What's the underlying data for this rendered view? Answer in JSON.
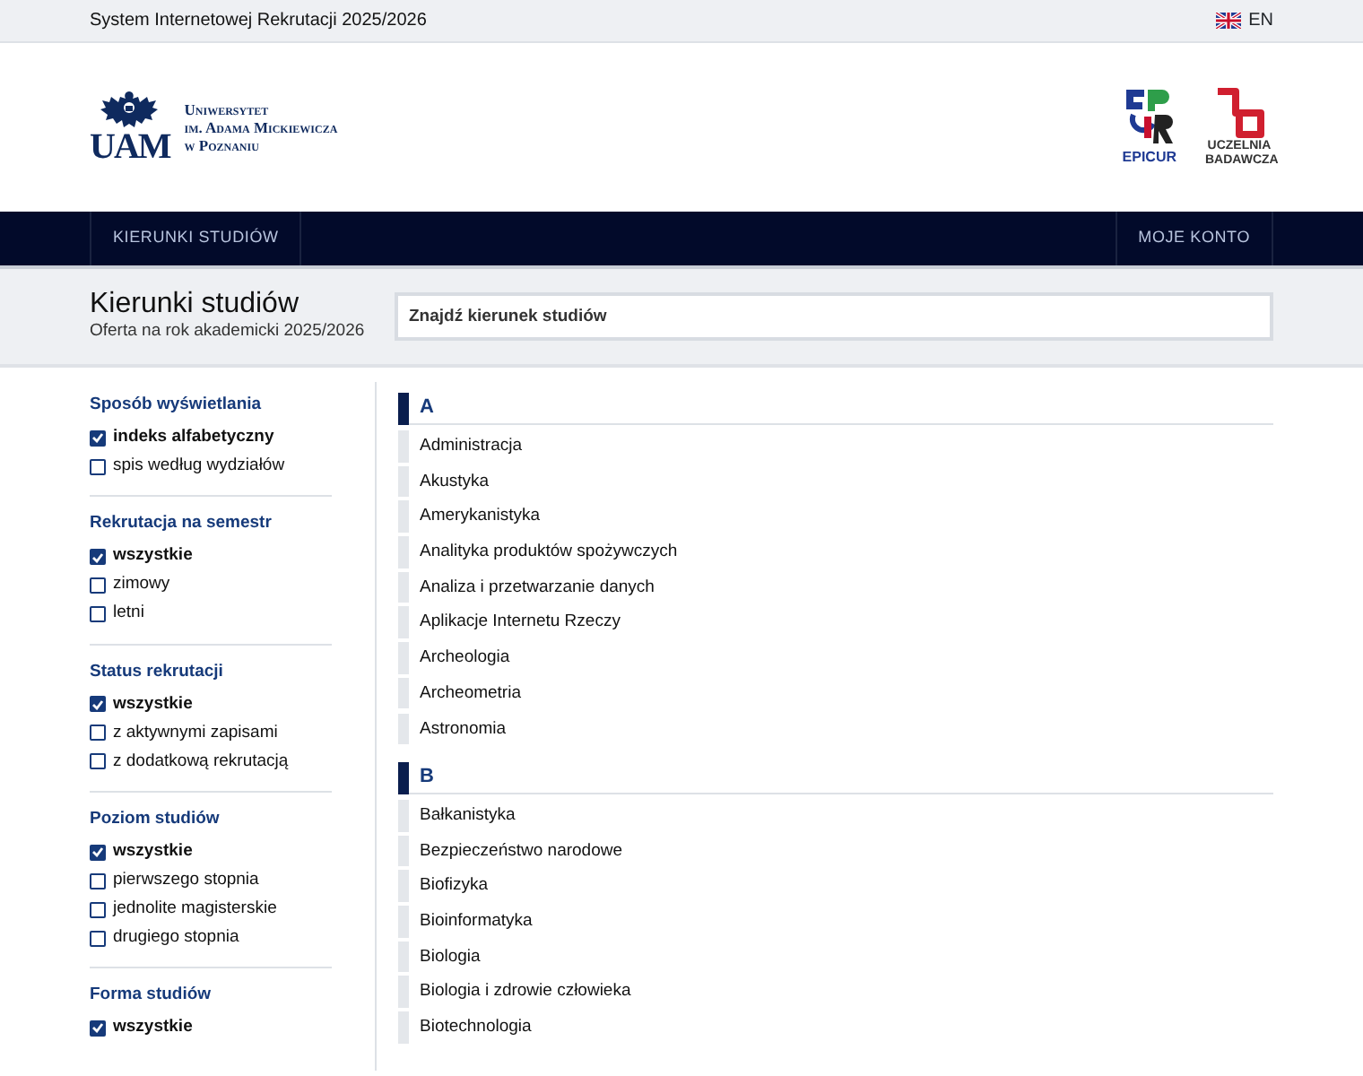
{
  "topbar": {
    "title": "System Internetowej Rekrutacji 2025/2026",
    "language": "EN"
  },
  "header": {
    "logo": {
      "monogram": "UAM",
      "lines": [
        "Uniwersytet",
        "im. Adama Mickiewicza",
        "w Poznaniu"
      ]
    },
    "partner_logos": [
      {
        "kind": "epicur",
        "text": "EPICUR"
      },
      {
        "kind": "research",
        "text": "UCZELNIA BADAWCZA"
      }
    ]
  },
  "nav": {
    "left": [
      "KIERUNKI STUDIÓW"
    ],
    "right": [
      "MOJE KONTO"
    ]
  },
  "page": {
    "title": "Kierunki studiów",
    "subtitle": "Oferta na rok akademicki 2025/2026",
    "search": {
      "placeholder": "Znajdź kierunek studiów"
    }
  },
  "filters": [
    {
      "title": "Sposób wyświetlania",
      "options": [
        {
          "label": "indeks alfabetyczny",
          "checked": true
        },
        {
          "label": "spis według wydziałów",
          "checked": false
        }
      ]
    },
    {
      "title": "Rekrutacja na semestr",
      "options": [
        {
          "label": "wszystkie",
          "checked": true
        },
        {
          "label": "zimowy",
          "checked": false
        },
        {
          "label": "letni",
          "checked": false
        }
      ]
    },
    {
      "title": "Status rekrutacji",
      "options": [
        {
          "label": "wszystkie",
          "checked": true
        },
        {
          "label": "z aktywnymi zapisami",
          "checked": false
        },
        {
          "label": "z dodatkową rekrutacją",
          "checked": false
        }
      ]
    },
    {
      "title": "Poziom studiów",
      "options": [
        {
          "label": "wszystkie",
          "checked": true
        },
        {
          "label": "pierwszego stopnia",
          "checked": false
        },
        {
          "label": "jednolite magisterskie",
          "checked": false
        },
        {
          "label": "drugiego stopnia",
          "checked": false
        }
      ]
    },
    {
      "title": "Forma studiów",
      "options": [
        {
          "label": "wszystkie",
          "checked": true
        }
      ]
    }
  ],
  "groups": [
    {
      "letter": "A",
      "items": [
        "Administracja",
        "Akustyka",
        "Amerykanistyka",
        "Analityka produktów spożywczych",
        "Analiza i przetwarzanie danych",
        "Aplikacje Internetu Rzeczy",
        "Archeologia",
        "Archeometria",
        "Astronomia"
      ]
    },
    {
      "letter": "B",
      "items": [
        "Bałkanistyka",
        "Bezpieczeństwo narodowe",
        "Biofizyka",
        "Bioinformatyka",
        "Biologia",
        "Biologia i zdrowie człowieka",
        "Biotechnologia"
      ]
    }
  ]
}
